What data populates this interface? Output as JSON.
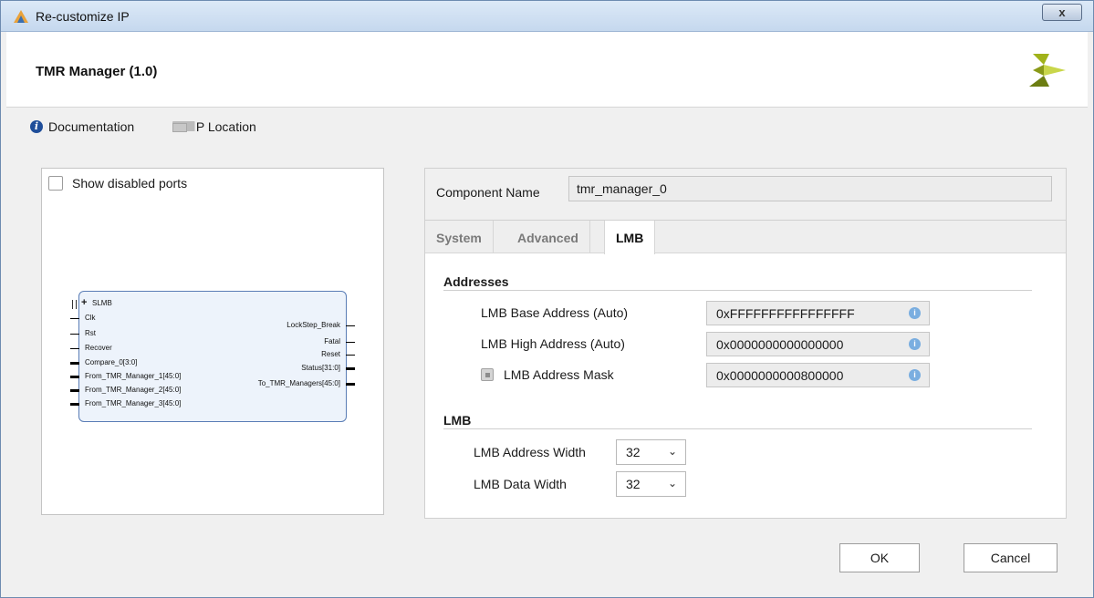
{
  "window": {
    "title": "Re-customize IP",
    "close_label": "x"
  },
  "header": {
    "ip_title": "TMR Manager (1.0)"
  },
  "docbar": {
    "documentation_label": "Documentation",
    "ip_location_label": "IP Location"
  },
  "left_panel": {
    "show_disabled_ports_label": "Show disabled ports",
    "show_disabled_ports_checked": false,
    "symbol": {
      "bus_interface": "SLMB",
      "left_ports": [
        "Clk",
        "Rst",
        "Recover",
        "Compare_0[3:0]",
        "From_TMR_Manager_1[45:0]",
        "From_TMR_Manager_2[45:0]",
        "From_TMR_Manager_3[45:0]"
      ],
      "right_ports": [
        "LockStep_Break",
        "Fatal",
        "Reset",
        "Status[31:0]",
        "To_TMR_Managers[45:0]"
      ]
    }
  },
  "right_panel": {
    "component_name_label": "Component Name",
    "component_name_value": "tmr_manager_0",
    "tabs": [
      {
        "label": "System",
        "active": false
      },
      {
        "label": "Advanced",
        "active": false
      },
      {
        "label": "LMB",
        "active": true
      }
    ],
    "addresses": {
      "title": "Addresses",
      "base_label": "LMB Base Address (Auto)",
      "base_value": "0xFFFFFFFFFFFFFFFF",
      "high_label": "LMB High Address (Auto)",
      "high_value": "0x0000000000000000",
      "mask_label": "LMB Address Mask",
      "mask_value": "0x0000000000800000"
    },
    "lmb": {
      "title": "LMB",
      "addr_width_label": "LMB Address Width",
      "addr_width_value": "32",
      "data_width_label": "LMB Data Width",
      "data_width_value": "32"
    }
  },
  "buttons": {
    "ok": "OK",
    "cancel": "Cancel"
  },
  "colors": {
    "accent_green": "#76b900",
    "info_blue": "#1f4e9a",
    "symbol_border": "#5a7db6"
  }
}
